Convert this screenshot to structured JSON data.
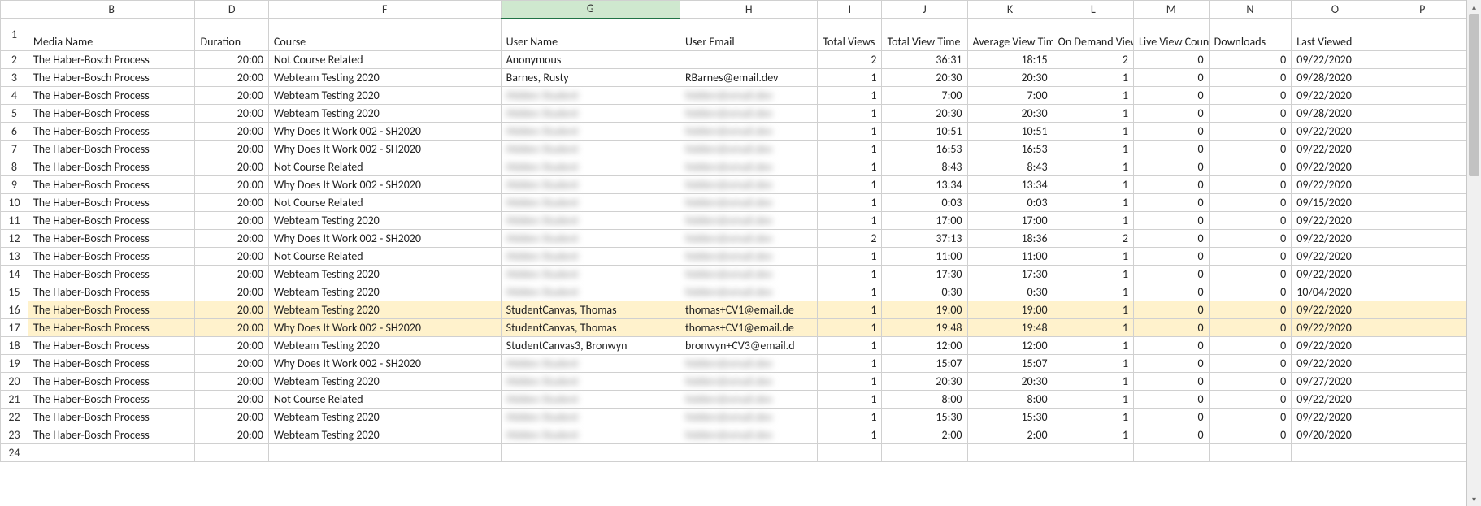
{
  "columns": {
    "letters": [
      "B",
      "D",
      "F",
      "G",
      "H",
      "I",
      "J",
      "K",
      "L",
      "M",
      "N",
      "O",
      "P"
    ],
    "selected": "G"
  },
  "headers": {
    "B": "Media Name",
    "D": "Duration",
    "F": "Course",
    "G": "User Name",
    "H": "User Email",
    "I": "Total Views",
    "J": "Total View Time",
    "K": "Average View Time",
    "L": "On Demand Views",
    "M": "Live View Count",
    "N": "Downloads",
    "O": "Last Viewed",
    "P": ""
  },
  "rows": [
    {
      "n": 2,
      "hl": false,
      "media": "The Haber-Bosch Process",
      "dur": "20:00",
      "course": "Not Course Related",
      "user": "Anonymous",
      "email": "",
      "blurUser": false,
      "blurEmail": false,
      "views": 2,
      "tvt": "36:31",
      "avt": "18:15",
      "od": 2,
      "lv": 0,
      "dl": 0,
      "last": "09/22/2020"
    },
    {
      "n": 3,
      "hl": false,
      "media": "The Haber-Bosch Process",
      "dur": "20:00",
      "course": "Webteam Testing 2020",
      "user": "Barnes, Rusty",
      "email": "RBarnes@email.dev",
      "blurUser": false,
      "blurEmail": false,
      "views": 1,
      "tvt": "20:30",
      "avt": "20:30",
      "od": 1,
      "lv": 0,
      "dl": 0,
      "last": "09/28/2020"
    },
    {
      "n": 4,
      "hl": false,
      "media": "The Haber-Bosch Process",
      "dur": "20:00",
      "course": "Webteam Testing 2020",
      "user": "Hidden Student",
      "email": "hidden@email.dev",
      "blurUser": true,
      "blurEmail": true,
      "views": 1,
      "tvt": "7:00",
      "avt": "7:00",
      "od": 1,
      "lv": 0,
      "dl": 0,
      "last": "09/22/2020"
    },
    {
      "n": 5,
      "hl": false,
      "media": "The Haber-Bosch Process",
      "dur": "20:00",
      "course": "Webteam Testing 2020",
      "user": "Hidden Student",
      "email": "hidden@email.dev",
      "blurUser": true,
      "blurEmail": true,
      "views": 1,
      "tvt": "20:30",
      "avt": "20:30",
      "od": 1,
      "lv": 0,
      "dl": 0,
      "last": "09/28/2020"
    },
    {
      "n": 6,
      "hl": false,
      "media": "The Haber-Bosch Process",
      "dur": "20:00",
      "course": "Why Does It Work 002 -  SH2020",
      "user": "Hidden Student",
      "email": "hidden@email.dev",
      "blurUser": true,
      "blurEmail": true,
      "views": 1,
      "tvt": "10:51",
      "avt": "10:51",
      "od": 1,
      "lv": 0,
      "dl": 0,
      "last": "09/22/2020"
    },
    {
      "n": 7,
      "hl": false,
      "media": "The Haber-Bosch Process",
      "dur": "20:00",
      "course": "Why Does It Work 002 -  SH2020",
      "user": "Hidden Student",
      "email": "hidden@email.dev",
      "blurUser": true,
      "blurEmail": true,
      "views": 1,
      "tvt": "16:53",
      "avt": "16:53",
      "od": 1,
      "lv": 0,
      "dl": 0,
      "last": "09/22/2020"
    },
    {
      "n": 8,
      "hl": false,
      "media": "The Haber-Bosch Process",
      "dur": "20:00",
      "course": "Not Course Related",
      "user": "Hidden Student",
      "email": "hidden@email.dev",
      "blurUser": true,
      "blurEmail": true,
      "views": 1,
      "tvt": "8:43",
      "avt": "8:43",
      "od": 1,
      "lv": 0,
      "dl": 0,
      "last": "09/22/2020"
    },
    {
      "n": 9,
      "hl": false,
      "media": "The Haber-Bosch Process",
      "dur": "20:00",
      "course": "Why Does It Work 002 -  SH2020",
      "user": "Hidden Student",
      "email": "hidden@email.dev",
      "blurUser": true,
      "blurEmail": true,
      "views": 1,
      "tvt": "13:34",
      "avt": "13:34",
      "od": 1,
      "lv": 0,
      "dl": 0,
      "last": "09/22/2020"
    },
    {
      "n": 10,
      "hl": false,
      "media": "The Haber-Bosch Process",
      "dur": "20:00",
      "course": "Not Course Related",
      "user": "Hidden Student",
      "email": "hidden@email.dev",
      "blurUser": true,
      "blurEmail": true,
      "views": 1,
      "tvt": "0:03",
      "avt": "0:03",
      "od": 1,
      "lv": 0,
      "dl": 0,
      "last": "09/15/2020"
    },
    {
      "n": 11,
      "hl": false,
      "media": "The Haber-Bosch Process",
      "dur": "20:00",
      "course": "Webteam Testing 2020",
      "user": "Hidden Student",
      "email": "hidden@email.dev",
      "blurUser": true,
      "blurEmail": true,
      "views": 1,
      "tvt": "17:00",
      "avt": "17:00",
      "od": 1,
      "lv": 0,
      "dl": 0,
      "last": "09/22/2020"
    },
    {
      "n": 12,
      "hl": false,
      "media": "The Haber-Bosch Process",
      "dur": "20:00",
      "course": "Why Does It Work 002 -  SH2020",
      "user": "Hidden Student",
      "email": "hidden@email.dev",
      "blurUser": true,
      "blurEmail": true,
      "views": 2,
      "tvt": "37:13",
      "avt": "18:36",
      "od": 2,
      "lv": 0,
      "dl": 0,
      "last": "09/22/2020"
    },
    {
      "n": 13,
      "hl": false,
      "media": "The Haber-Bosch Process",
      "dur": "20:00",
      "course": "Not Course Related",
      "user": "Hidden Student",
      "email": "hidden@email.dev",
      "blurUser": true,
      "blurEmail": true,
      "views": 1,
      "tvt": "11:00",
      "avt": "11:00",
      "od": 1,
      "lv": 0,
      "dl": 0,
      "last": "09/22/2020"
    },
    {
      "n": 14,
      "hl": false,
      "media": "The Haber-Bosch Process",
      "dur": "20:00",
      "course": "Webteam Testing 2020",
      "user": "Hidden Student",
      "email": "hidden@email.dev",
      "blurUser": true,
      "blurEmail": true,
      "views": 1,
      "tvt": "17:30",
      "avt": "17:30",
      "od": 1,
      "lv": 0,
      "dl": 0,
      "last": "09/22/2020"
    },
    {
      "n": 15,
      "hl": false,
      "media": "The Haber-Bosch Process",
      "dur": "20:00",
      "course": "Webteam Testing 2020",
      "user": "Hidden Student",
      "email": "hidden@email.dev",
      "blurUser": true,
      "blurEmail": true,
      "views": 1,
      "tvt": "0:30",
      "avt": "0:30",
      "od": 1,
      "lv": 0,
      "dl": 0,
      "last": "10/04/2020"
    },
    {
      "n": 16,
      "hl": true,
      "media": "The Haber-Bosch Process",
      "dur": "20:00",
      "course": "Webteam Testing 2020",
      "user": "StudentCanvas, Thomas",
      "email": "thomas+CV1@email.de",
      "blurUser": false,
      "blurEmail": false,
      "views": 1,
      "tvt": "19:00",
      "avt": "19:00",
      "od": 1,
      "lv": 0,
      "dl": 0,
      "last": "09/22/2020"
    },
    {
      "n": 17,
      "hl": true,
      "media": "The Haber-Bosch Process",
      "dur": "20:00",
      "course": "Why Does It Work 002 -  SH2020",
      "user": "StudentCanvas, Thomas",
      "email": "thomas+CV1@email.de",
      "blurUser": false,
      "blurEmail": false,
      "views": 1,
      "tvt": "19:48",
      "avt": "19:48",
      "od": 1,
      "lv": 0,
      "dl": 0,
      "last": "09/22/2020"
    },
    {
      "n": 18,
      "hl": false,
      "media": "The Haber-Bosch Process",
      "dur": "20:00",
      "course": "Webteam Testing 2020",
      "user": "StudentCanvas3, Bronwyn",
      "email": "bronwyn+CV3@email.d",
      "blurUser": false,
      "blurEmail": false,
      "views": 1,
      "tvt": "12:00",
      "avt": "12:00",
      "od": 1,
      "lv": 0,
      "dl": 0,
      "last": "09/22/2020"
    },
    {
      "n": 19,
      "hl": false,
      "media": "The Haber-Bosch Process",
      "dur": "20:00",
      "course": "Why Does It Work 002 -  SH2020",
      "user": "Hidden Student",
      "email": "hidden@email.dev",
      "blurUser": true,
      "blurEmail": true,
      "views": 1,
      "tvt": "15:07",
      "avt": "15:07",
      "od": 1,
      "lv": 0,
      "dl": 0,
      "last": "09/22/2020"
    },
    {
      "n": 20,
      "hl": false,
      "media": "The Haber-Bosch Process",
      "dur": "20:00",
      "course": "Webteam Testing 2020",
      "user": "Hidden Student",
      "email": "hidden@email.dev",
      "blurUser": true,
      "blurEmail": true,
      "views": 1,
      "tvt": "20:30",
      "avt": "20:30",
      "od": 1,
      "lv": 0,
      "dl": 0,
      "last": "09/27/2020"
    },
    {
      "n": 21,
      "hl": false,
      "media": "The Haber-Bosch Process",
      "dur": "20:00",
      "course": "Not Course Related",
      "user": "Hidden Student",
      "email": "hidden@email.dev",
      "blurUser": true,
      "blurEmail": true,
      "views": 1,
      "tvt": "8:00",
      "avt": "8:00",
      "od": 1,
      "lv": 0,
      "dl": 0,
      "last": "09/22/2020"
    },
    {
      "n": 22,
      "hl": false,
      "media": "The Haber-Bosch Process",
      "dur": "20:00",
      "course": "Webteam Testing 2020",
      "user": "Hidden Student",
      "email": "hidden@email.dev",
      "blurUser": true,
      "blurEmail": true,
      "views": 1,
      "tvt": "15:30",
      "avt": "15:30",
      "od": 1,
      "lv": 0,
      "dl": 0,
      "last": "09/22/2020"
    },
    {
      "n": 23,
      "hl": false,
      "media": "The Haber-Bosch Process",
      "dur": "20:00",
      "course": "Webteam Testing 2020",
      "user": "Hidden Student",
      "email": "hidden@email.dev",
      "blurUser": true,
      "blurEmail": true,
      "views": 1,
      "tvt": "2:00",
      "avt": "2:00",
      "od": 1,
      "lv": 0,
      "dl": 0,
      "last": "09/20/2020"
    }
  ],
  "empty_row": 24
}
